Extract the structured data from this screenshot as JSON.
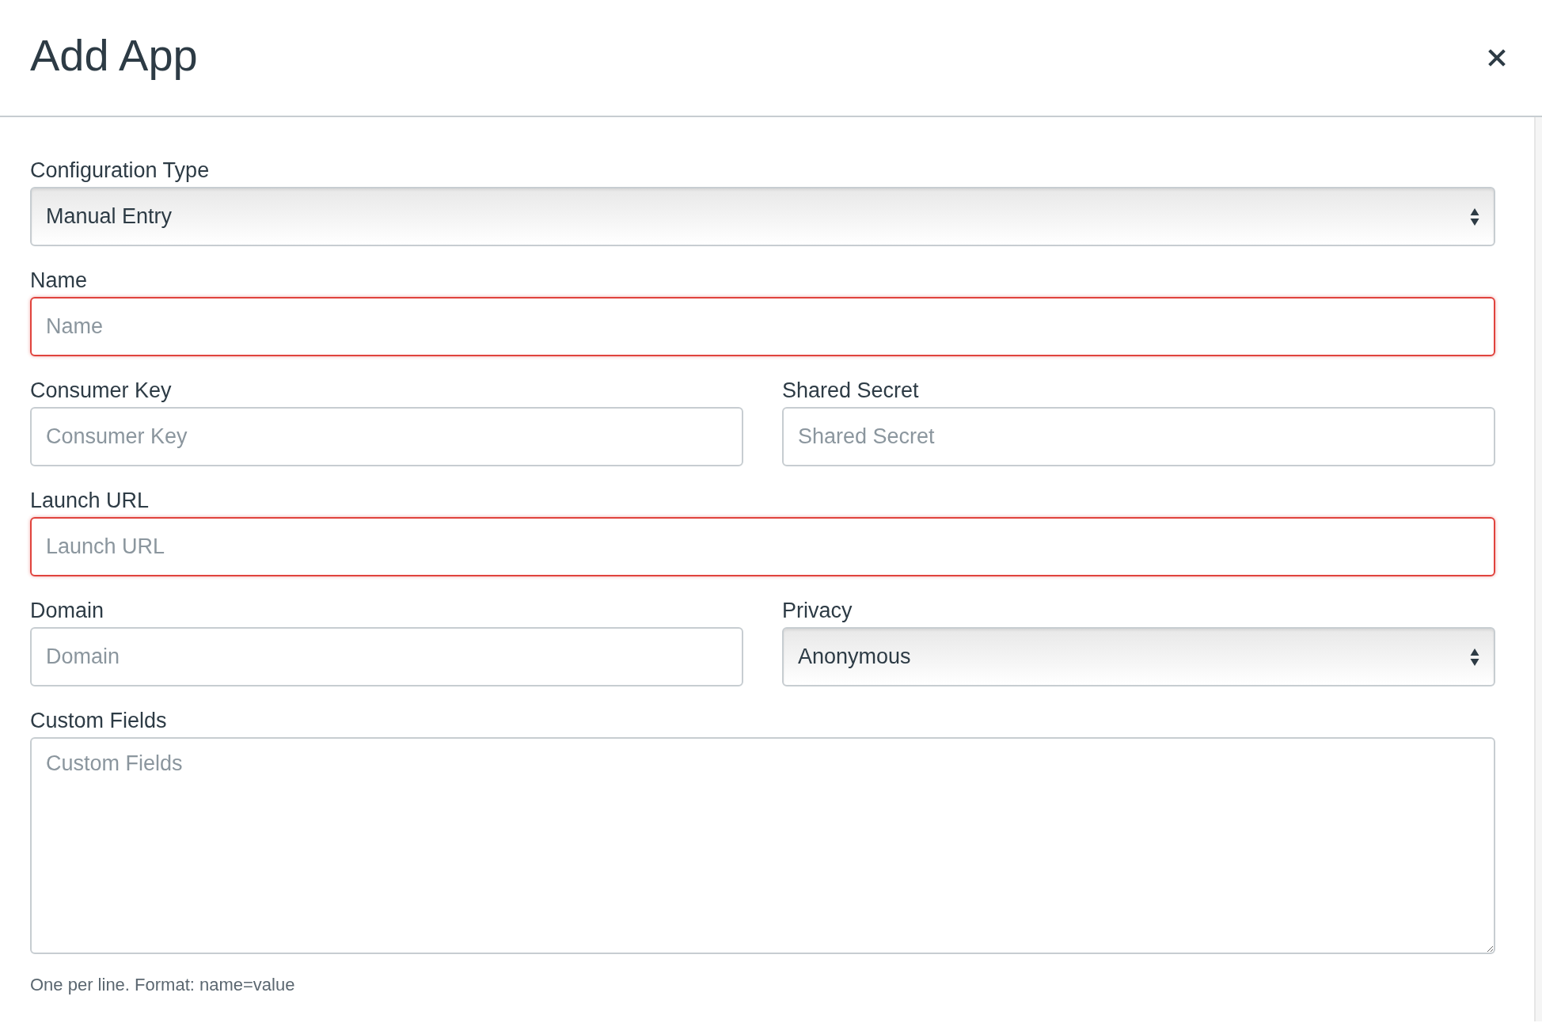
{
  "dialog": {
    "title": "Add App"
  },
  "rows": [
    [
      {
        "kind": "select",
        "label": "Configuration Type",
        "value": "Manual Entry",
        "error": false
      }
    ],
    [
      {
        "kind": "input",
        "label": "Name",
        "placeholder": "Name",
        "error": true
      }
    ],
    [
      {
        "kind": "input",
        "label": "Consumer Key",
        "placeholder": "Consumer Key",
        "error": false
      },
      {
        "kind": "input",
        "label": "Shared Secret",
        "placeholder": "Shared Secret",
        "error": false
      }
    ],
    [
      {
        "kind": "input",
        "label": "Launch URL",
        "placeholder": "Launch URL",
        "error": true
      }
    ],
    [
      {
        "kind": "input",
        "label": "Domain",
        "placeholder": "Domain",
        "error": false
      },
      {
        "kind": "select",
        "label": "Privacy",
        "value": "Anonymous",
        "error": false
      }
    ],
    [
      {
        "kind": "textarea",
        "label": "Custom Fields",
        "placeholder": "Custom Fields",
        "error": false
      }
    ]
  ],
  "hint": "One per line. Format: name=value"
}
